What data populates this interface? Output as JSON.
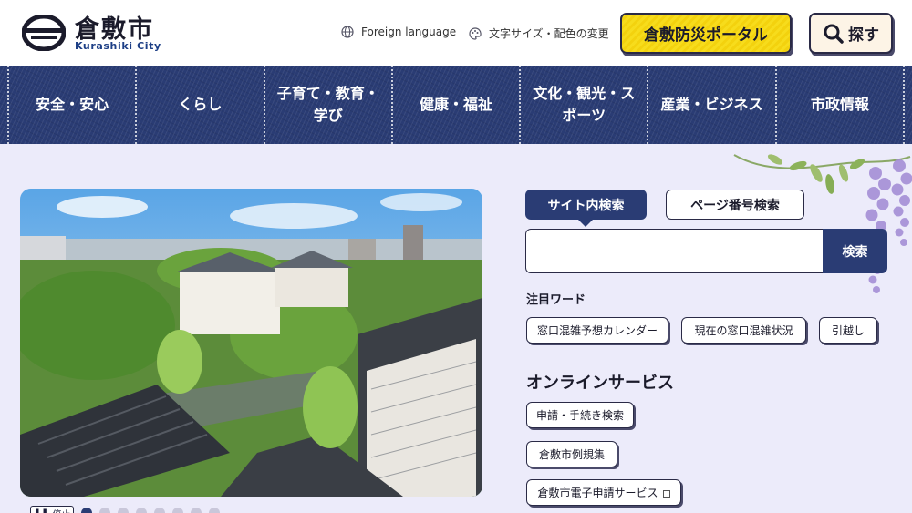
{
  "header": {
    "logo_title": "倉敷市",
    "logo_subtitle": "Kurashiki City",
    "foreign_language": "Foreign language",
    "text_size_color": "文字サイズ・配色の変更",
    "portal_button": "倉敷防災ポータル",
    "search_button": "探す"
  },
  "nav": {
    "items": [
      "安全・安心",
      "くらし",
      "子育て・教育・学び",
      "健康・福祉",
      "文化・観光・スポーツ",
      "産業・ビジネス",
      "市政情報"
    ]
  },
  "slider": {
    "pause_label": "停止",
    "slide_count": 8,
    "active_slide": 1
  },
  "search": {
    "tab_site": "サイト内検索",
    "tab_page": "ページ番号検索",
    "submit": "検索",
    "input_value": "",
    "placeholder": ""
  },
  "featured": {
    "label": "注目ワード",
    "chips": [
      "窓口混雑予想カレンダー",
      "現在の窓口混雑状況",
      "引越し"
    ]
  },
  "online": {
    "heading": "オンラインサービス",
    "items": [
      "申請・手続き検索",
      "倉敷市例規集",
      "倉敷市電子申請サービス"
    ]
  },
  "colors": {
    "navy": "#2a3c74",
    "page_bg": "#ecebfa",
    "portal_yellow": "#f3d20e",
    "search_btn_bg": "#fdf4e6"
  }
}
